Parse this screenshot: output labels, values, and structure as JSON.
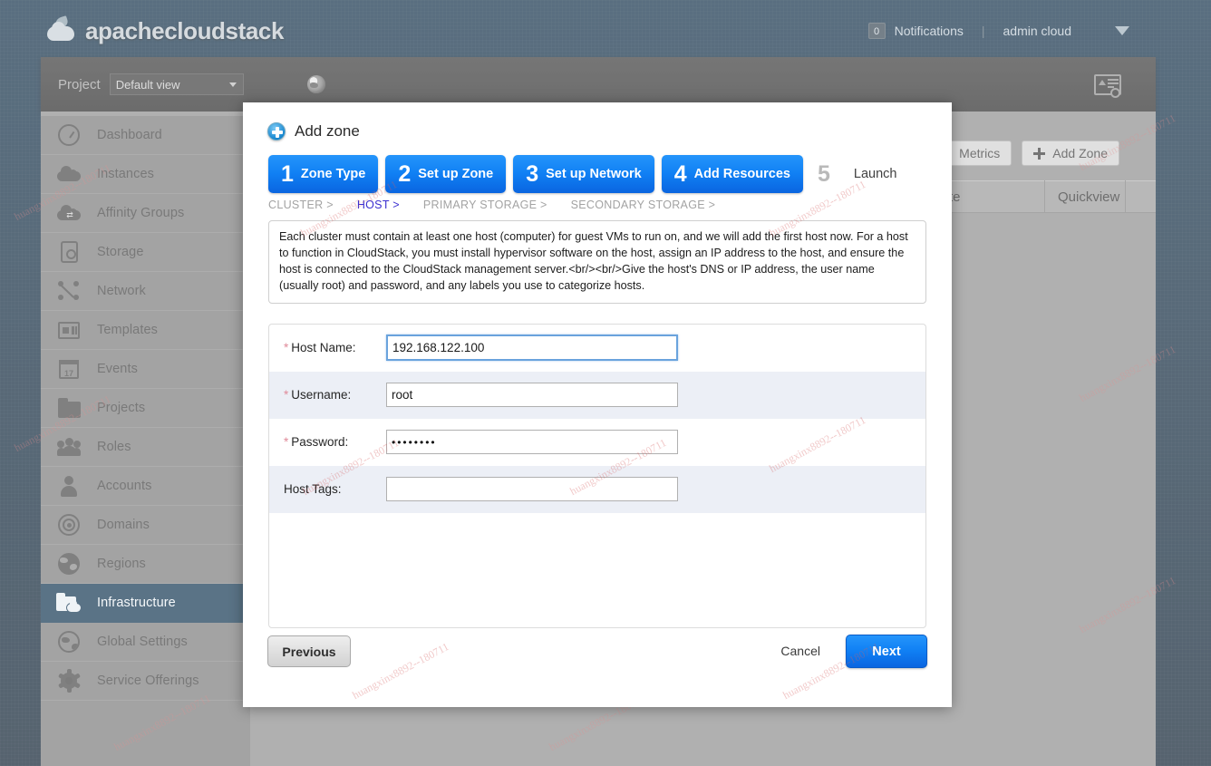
{
  "header": {
    "brand": "apachecloudstack",
    "notifications_count": "0",
    "notifications_label": "Notifications",
    "separator": "|",
    "user": "admin cloud"
  },
  "apptoolbar": {
    "project_label": "Project",
    "project_value": "Default view"
  },
  "content": {
    "metrics_button": "Metrics",
    "add_zone_button": "Add Zone",
    "table_headers": [
      "te",
      "Quickview"
    ]
  },
  "sidebar": {
    "items": [
      {
        "label": "Dashboard",
        "icon": "dashboard-icon",
        "active": false
      },
      {
        "label": "Instances",
        "icon": "cloud-icon",
        "active": false
      },
      {
        "label": "Affinity Groups",
        "icon": "cloud-arrows-icon",
        "active": false
      },
      {
        "label": "Storage",
        "icon": "disk-icon",
        "active": false
      },
      {
        "label": "Network",
        "icon": "network-nodes-icon",
        "active": false
      },
      {
        "label": "Templates",
        "icon": "template-icon",
        "active": false
      },
      {
        "label": "Events",
        "icon": "calendar-icon",
        "active": false
      },
      {
        "label": "Projects",
        "icon": "folder-icon",
        "active": false
      },
      {
        "label": "Roles",
        "icon": "user-group-icon",
        "active": false
      },
      {
        "label": "Accounts",
        "icon": "user-icon",
        "active": false
      },
      {
        "label": "Domains",
        "icon": "target-rings-icon",
        "active": false
      },
      {
        "label": "Regions",
        "icon": "globe-icon",
        "active": false
      },
      {
        "label": "Infrastructure",
        "icon": "folder-cloud-icon",
        "active": true
      },
      {
        "label": "Global Settings",
        "icon": "globe-outline-icon",
        "active": false
      },
      {
        "label": "Service Offerings",
        "icon": "gear-icon",
        "active": false
      }
    ]
  },
  "modal": {
    "title": "Add zone",
    "steps": [
      {
        "num": "1",
        "label": "Zone Type",
        "active": true
      },
      {
        "num": "2",
        "label": "Set up Zone",
        "active": true
      },
      {
        "num": "3",
        "label": "Set up Network",
        "active": true
      },
      {
        "num": "4",
        "label": "Add Resources",
        "active": true
      },
      {
        "num": "5",
        "label": "Launch",
        "active": false
      }
    ],
    "breadcrumbs": [
      {
        "label": "CLUSTER >",
        "active": false
      },
      {
        "label": "HOST >",
        "active": true
      },
      {
        "label": "PRIMARY STORAGE >",
        "active": false
      },
      {
        "label": "SECONDARY STORAGE >",
        "active": false
      }
    ],
    "description": "Each cluster must contain at least one host (computer) for guest VMs to run on, and we will add the first host now. For a host to function in CloudStack, you must install hypervisor software on the host, assign an IP address to the host, and ensure the host is connected to the CloudStack management server.<br/><br/>Give the host's DNS or IP address, the user name (usually root) and password, and any labels you use to categorize hosts.",
    "form": {
      "rows": [
        {
          "label": "Host Name:",
          "required": true,
          "value": "192.168.122.100",
          "focused": true,
          "type": "text"
        },
        {
          "label": "Username:",
          "required": true,
          "value": "root",
          "focused": false,
          "type": "text"
        },
        {
          "label": "Password:",
          "required": true,
          "value": "••••••••",
          "focused": false,
          "type": "password"
        },
        {
          "label": "Host Tags:",
          "required": false,
          "value": "",
          "focused": false,
          "type": "text"
        }
      ]
    },
    "footer": {
      "previous": "Previous",
      "cancel": "Cancel",
      "next": "Next"
    }
  },
  "watermark": {
    "text": "huangxinx8892--180711"
  }
}
